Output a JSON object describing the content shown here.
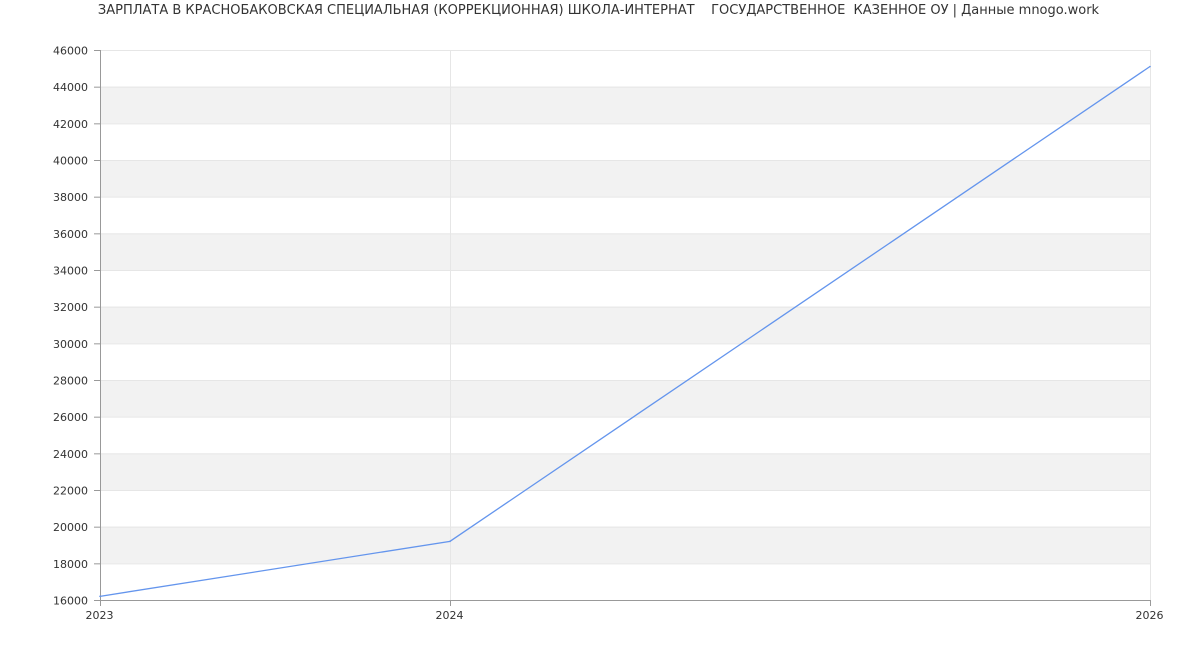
{
  "chart_data": {
    "type": "line",
    "title": "ЗАРПЛАТА В КРАСНОБАКОВСКАЯ СПЕЦИАЛЬНАЯ (КОРРЕКЦИОННАЯ) ШКОЛА-ИНТЕРНАТ    ГОСУДАРСТВЕННОЕ  КАЗЕННОЕ ОУ | Данные mnogo.work",
    "x_ticks": [
      "2023",
      "2024",
      "2026"
    ],
    "y_ticks": [
      "16000",
      "18000",
      "20000",
      "22000",
      "24000",
      "26000",
      "28000",
      "30000",
      "32000",
      "34000",
      "36000",
      "38000",
      "40000",
      "42000",
      "44000",
      "46000"
    ],
    "ylim": [
      16000,
      46000
    ],
    "series": [
      {
        "x": [
          "2023",
          "2024",
          "2026"
        ],
        "values": [
          16200,
          19200,
          45100
        ]
      }
    ],
    "grid": true,
    "line_color": "#6495ed",
    "band_color": "#f2f2f2",
    "grid_color": "#e6e6e6",
    "axis_color": "#999999"
  }
}
